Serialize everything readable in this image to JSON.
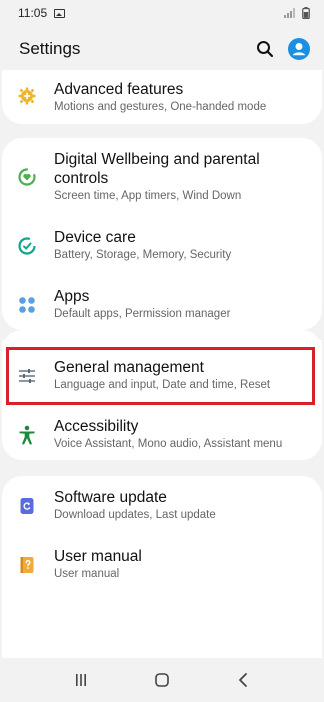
{
  "status_bar": {
    "time": "11:05",
    "icons": [
      "image-notification-icon",
      "signal-icon",
      "battery-icon"
    ]
  },
  "header": {
    "title": "Settings",
    "actions": [
      "search-icon",
      "account-icon"
    ]
  },
  "colors": {
    "advanced_icon": "#f0b429",
    "wellbeing_icon": "#4caf50",
    "device_care_icon": "#14a38b",
    "apps_icon": "#5a9fe0",
    "general_icon": "#5b6a78",
    "accessibility_icon": "#1b8a3c",
    "software_update_icon": "#5a6be0",
    "user_manual_icon": "#f0a93b",
    "account_icon": "#1a8fe3",
    "highlight": "#d9202a"
  },
  "items": [
    {
      "id": "advanced-features",
      "title": "Advanced features",
      "subtitle": "Motions and gestures, One-handed mode",
      "icon": "gear-plus-icon"
    },
    {
      "id": "digital-wellbeing",
      "title": "Digital Wellbeing and parental controls",
      "subtitle": "Screen time, App timers, Wind Down",
      "icon": "wellbeing-icon"
    },
    {
      "id": "device-care",
      "title": "Device care",
      "subtitle": "Battery, Storage, Memory, Security",
      "icon": "device-care-icon"
    },
    {
      "id": "apps",
      "title": "Apps",
      "subtitle": "Default apps, Permission manager",
      "icon": "apps-grid-icon"
    },
    {
      "id": "general-management",
      "title": "General management",
      "subtitle": "Language and input, Date and time, Reset",
      "icon": "sliders-icon"
    },
    {
      "id": "accessibility",
      "title": "Accessibility",
      "subtitle": "Voice Assistant, Mono audio, Assistant menu",
      "icon": "accessibility-icon"
    },
    {
      "id": "software-update",
      "title": "Software update",
      "subtitle": "Download updates, Last update",
      "icon": "software-update-icon"
    },
    {
      "id": "user-manual",
      "title": "User manual",
      "subtitle": "User manual",
      "icon": "user-manual-icon"
    }
  ],
  "nav_bar": [
    "recent-apps-icon",
    "home-icon",
    "back-icon"
  ]
}
